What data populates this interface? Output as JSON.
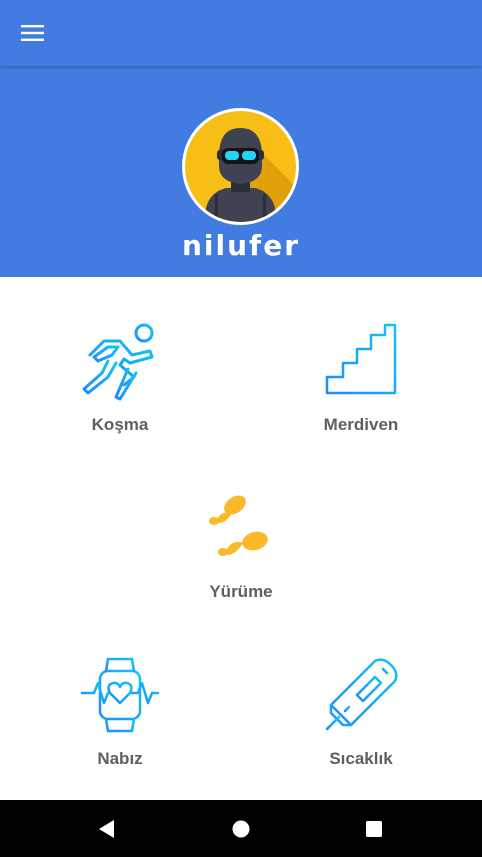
{
  "toolbar": {
    "menu_icon": "hamburger-menu-icon"
  },
  "header": {
    "username": "nilufer",
    "avatar_icon": "masked-person-avatar",
    "background_color": "#437CE1"
  },
  "activities": [
    {
      "label": "Koşma",
      "icon": "running-icon"
    },
    {
      "label": "Merdiven",
      "icon": "stairs-icon"
    },
    {
      "label": "Yürüme",
      "icon": "footprints-icon"
    },
    {
      "label": "Nabız",
      "icon": "heart-rate-watch-icon"
    },
    {
      "label": "Sıcaklık",
      "icon": "thermometer-icon"
    }
  ],
  "navbar": {
    "back_icon": "back-icon",
    "home_icon": "home-icon",
    "recents_icon": "recents-icon"
  },
  "colors": {
    "accent_blue": "#437CE1",
    "icon_gradient_start": "#1E8CFF",
    "icon_gradient_end": "#12C6F2",
    "footprints": "#FBB829"
  }
}
